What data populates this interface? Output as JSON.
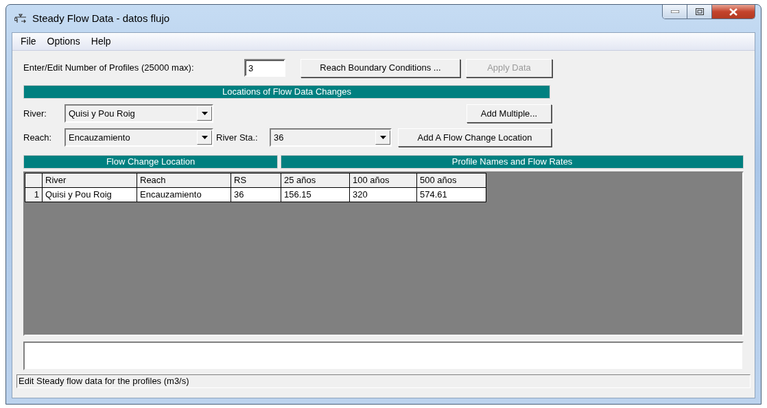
{
  "window": {
    "title": "Steady Flow Data - datos flujo"
  },
  "menu": [
    {
      "label": "File"
    },
    {
      "label": "Options"
    },
    {
      "label": "Help"
    }
  ],
  "profiles": {
    "label": "Enter/Edit Number of Profiles (25000 max):",
    "value": "3"
  },
  "top_buttons": [
    {
      "label": "Reach Boundary Conditions ...",
      "disabled": false
    },
    {
      "label": "Apply Data",
      "disabled": true
    }
  ],
  "locations": {
    "header": "Locations of Flow Data Changes",
    "river": {
      "label": "River:",
      "value": "Quisi y Pou Roig"
    },
    "reach": {
      "label": "Reach:",
      "value": "Encauzamiento"
    },
    "river_station": {
      "label": "River Sta.:",
      "value": "36"
    },
    "add_multiple": {
      "label": "Add Multiple...",
      "disabled": false
    },
    "add_location": {
      "label": "Add A Flow Change Location",
      "disabled": false
    }
  },
  "table": {
    "group_headers": [
      "Flow Change Location",
      "Profile Names and Flow Rates"
    ],
    "columns": [
      "River",
      "Reach",
      "RS",
      "25 años",
      "100 años",
      "500 años"
    ],
    "rows": [
      {
        "number": "1",
        "cells": [
          "Quisi y Pou Roig",
          "Encauzamiento",
          "36",
          "156.15",
          "320",
          "574.61"
        ]
      }
    ]
  },
  "status_bar": "Edit Steady flow data for the profiles (m3/s)"
}
